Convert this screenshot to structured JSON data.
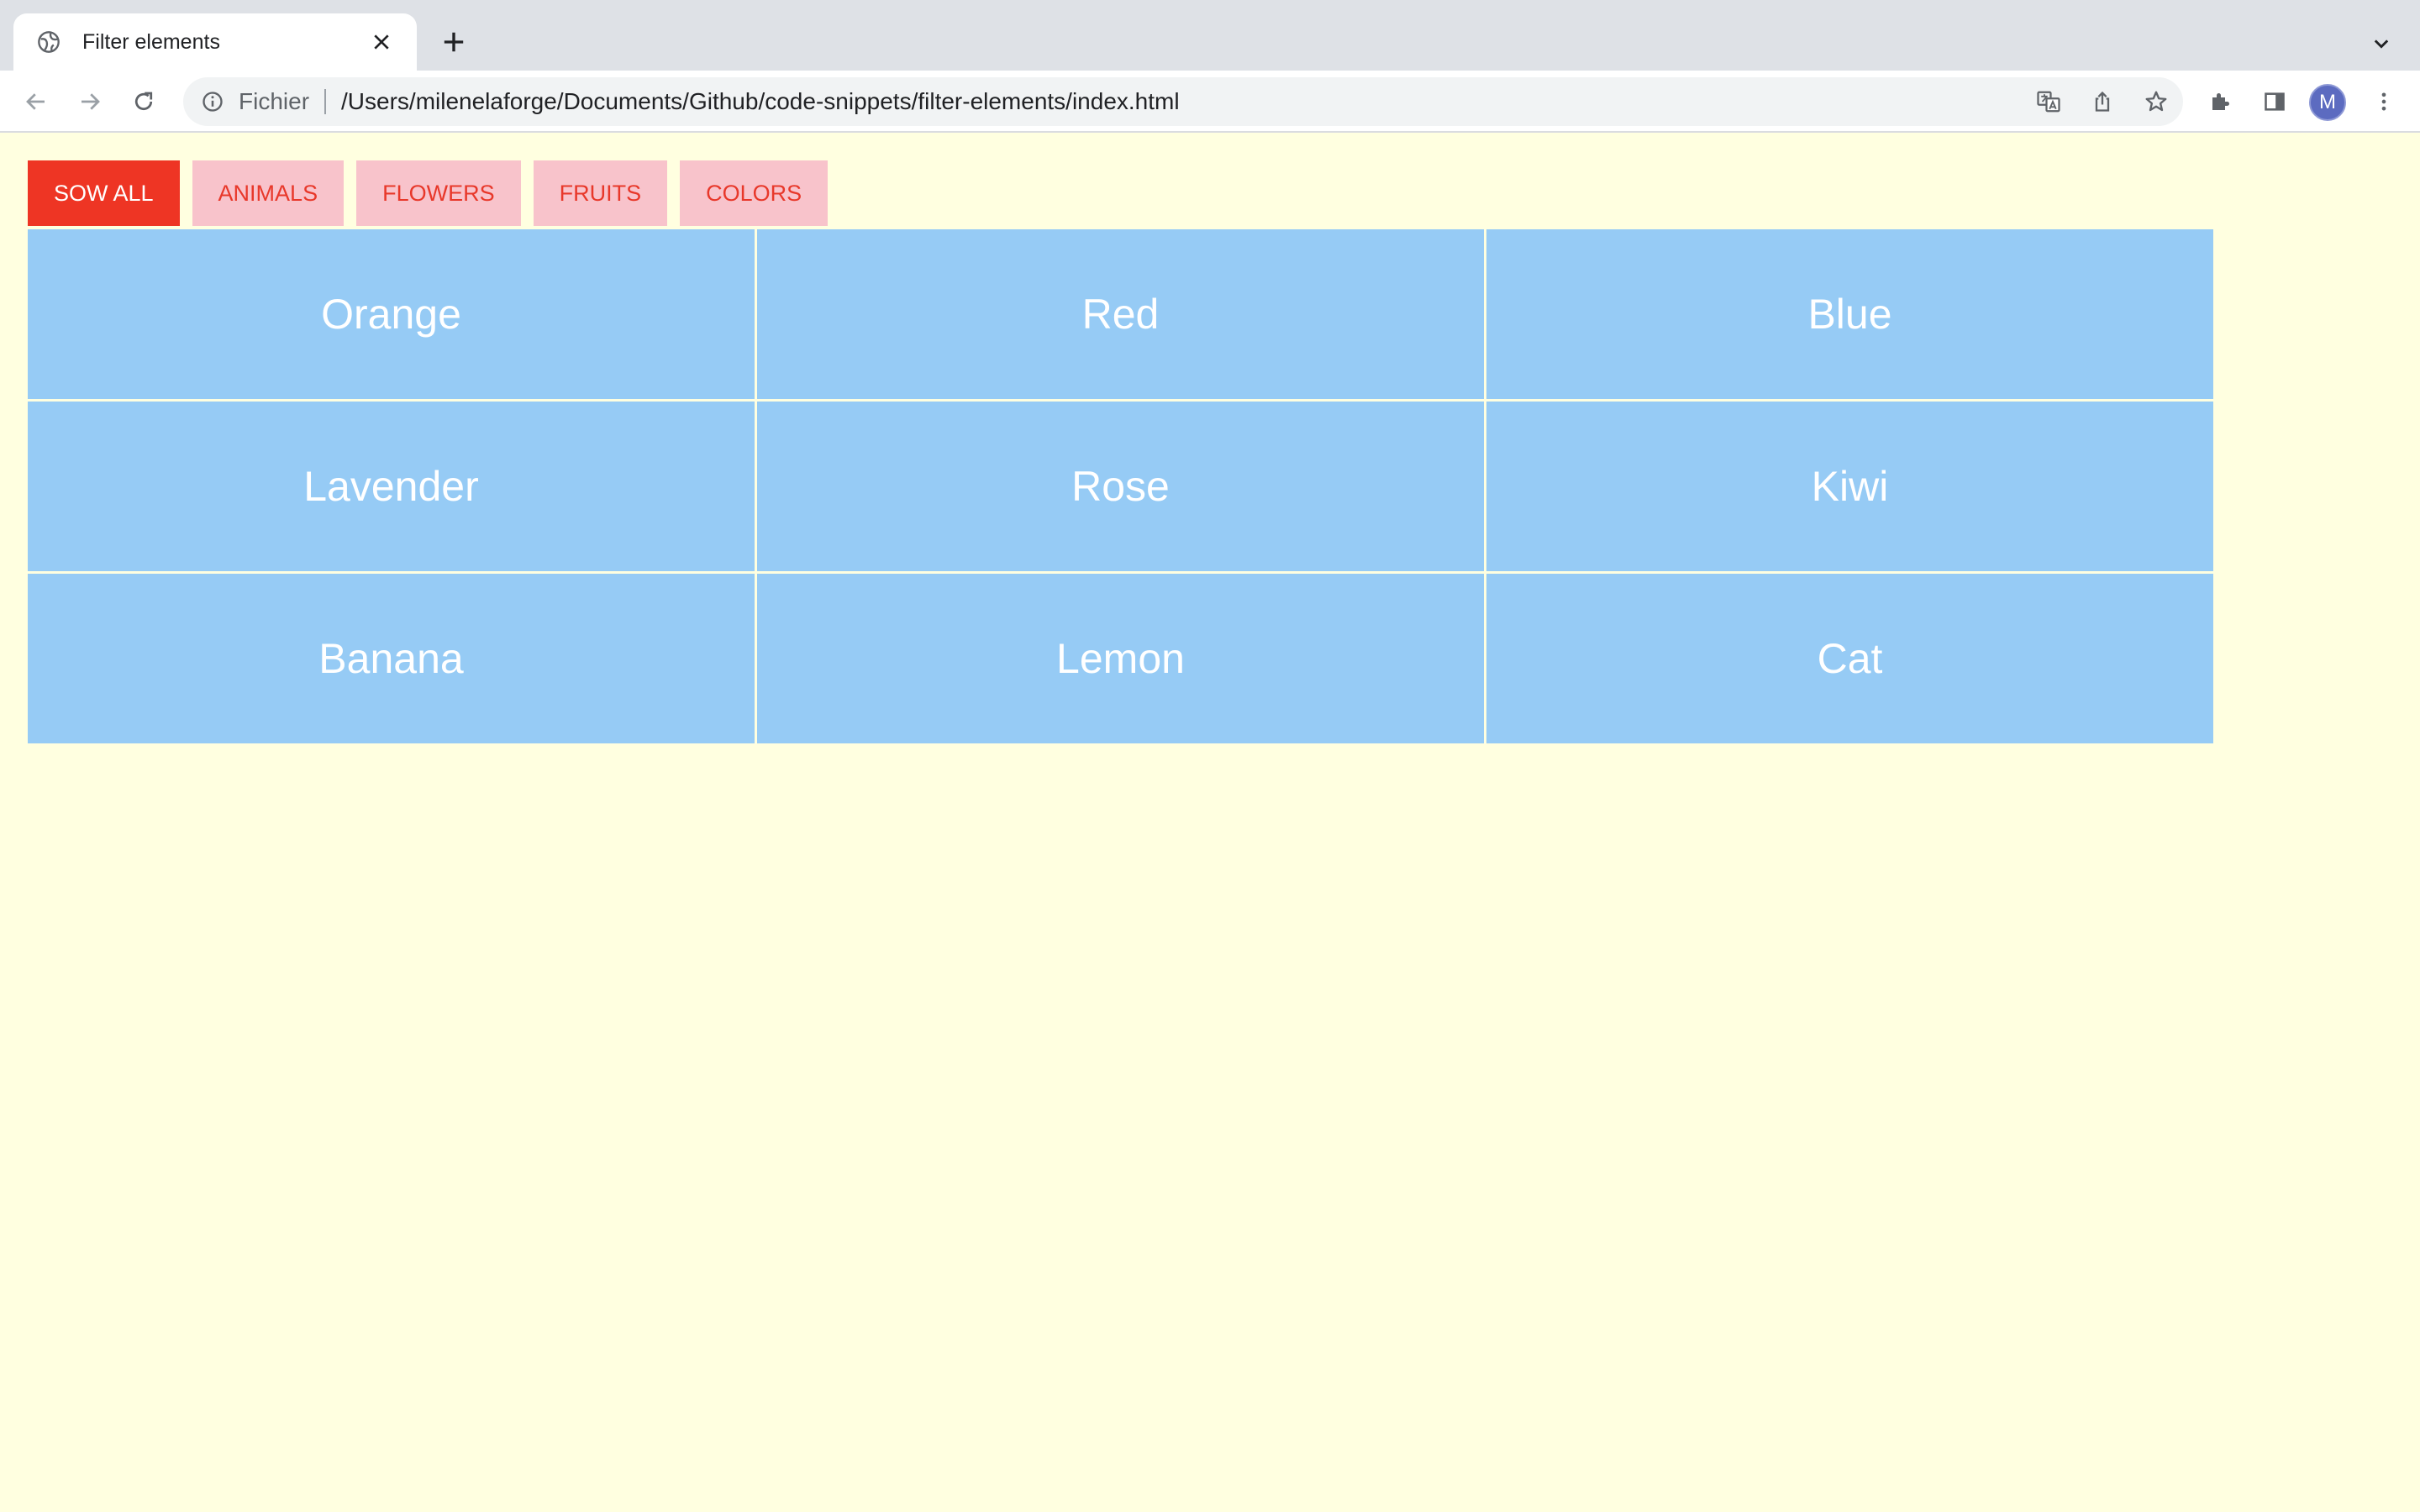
{
  "browser": {
    "tab_title": "Filter elements",
    "omnibox_label": "Fichier",
    "url": "/Users/milenelaforge/Documents/Github/code-snippets/filter-elements/index.html",
    "profile_initial": "M"
  },
  "filters": [
    {
      "label": "SOW ALL",
      "active": true
    },
    {
      "label": "ANIMALS",
      "active": false
    },
    {
      "label": "FLOWERS",
      "active": false
    },
    {
      "label": "FRUITS",
      "active": false
    },
    {
      "label": "COLORS",
      "active": false
    }
  ],
  "items": [
    "Orange",
    "Red",
    "Blue",
    "Lavender",
    "Rose",
    "Kiwi",
    "Banana",
    "Lemon",
    "Cat"
  ],
  "colors": {
    "page_bg": "#ffffe0",
    "filter_active_bg": "#ee3524",
    "filter_bg": "#f8c3cb",
    "filter_text": "#e8382a",
    "cell_bg": "#96cbf5"
  }
}
